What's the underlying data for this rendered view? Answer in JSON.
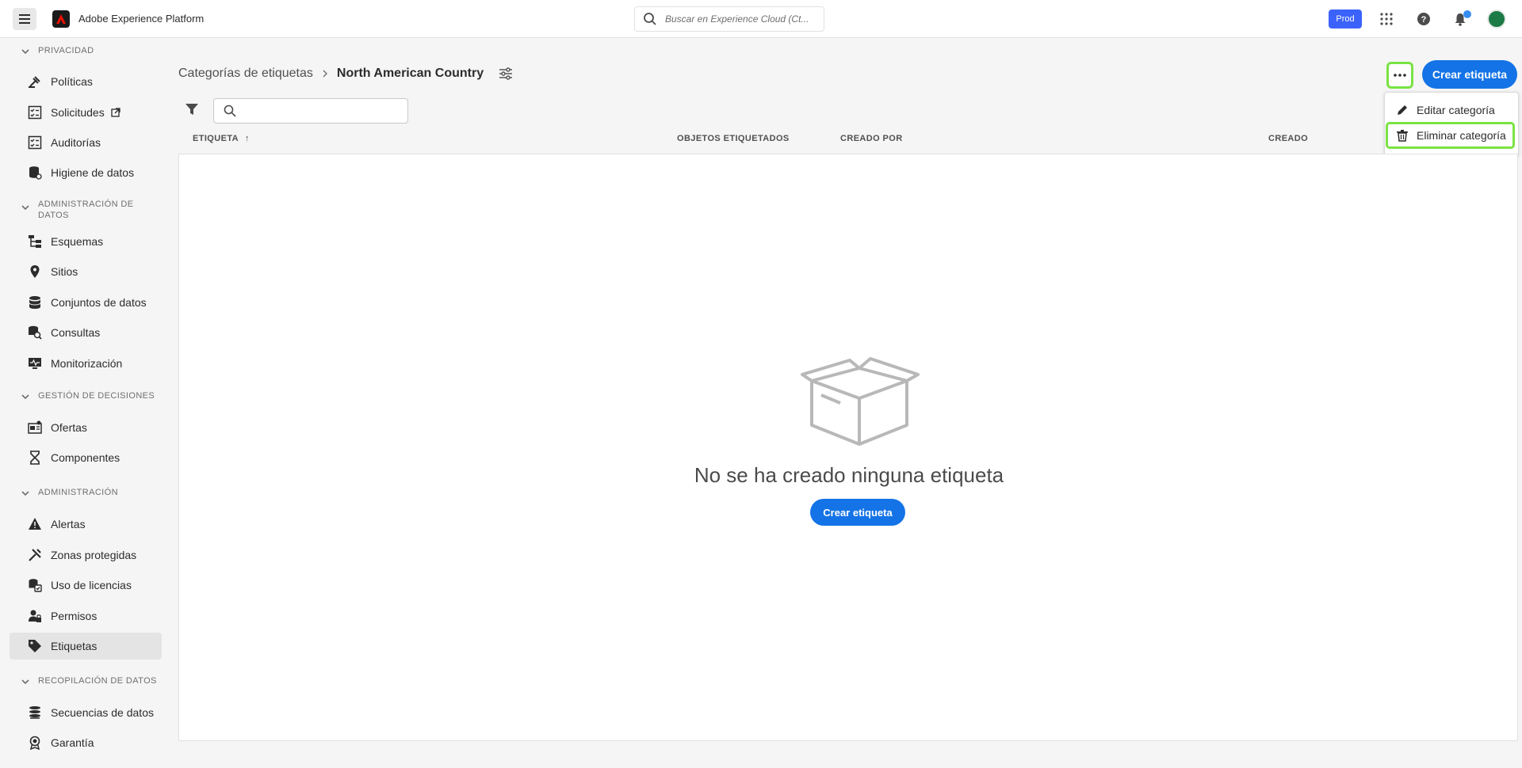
{
  "app": {
    "title": "Adobe Experience Platform"
  },
  "search": {
    "placeholder": "Buscar en Experience Cloud (Ct..."
  },
  "topbar": {
    "sandbox": "Prod"
  },
  "sidebar": {
    "sections": [
      {
        "label": "PRIVACIDAD"
      },
      {
        "label": "ADMINISTRACIÓN DE DATOS"
      },
      {
        "label": "GESTIÓN DE DECISIONES"
      },
      {
        "label": "ADMINISTRACIÓN"
      },
      {
        "label": "RECOPILACIÓN DE DATOS"
      }
    ],
    "items": [
      {
        "label": "Políticas",
        "icon": "policy-icon"
      },
      {
        "label": "Solicitudes",
        "icon": "checklist-icon"
      },
      {
        "label": "Auditorías",
        "icon": "audit-icon"
      },
      {
        "label": "Higiene de datos",
        "icon": "database-clean-icon"
      },
      {
        "label": "Esquemas",
        "icon": "schema-icon"
      },
      {
        "label": "Sitios",
        "icon": "location-pin-icon"
      },
      {
        "label": "Conjuntos de datos",
        "icon": "database-icon"
      },
      {
        "label": "Consultas",
        "icon": "query-icon"
      },
      {
        "label": "Monitorización",
        "icon": "monitor-icon"
      },
      {
        "label": "Ofertas",
        "icon": "offers-icon"
      },
      {
        "label": "Componentes",
        "icon": "hourglass-icon"
      },
      {
        "label": "Alertas",
        "icon": "alert-icon"
      },
      {
        "label": "Zonas protegidas",
        "icon": "tools-icon"
      },
      {
        "label": "Uso de licencias",
        "icon": "license-icon"
      },
      {
        "label": "Permisos",
        "icon": "user-lock-icon"
      },
      {
        "label": "Etiquetas",
        "icon": "tag-icon"
      },
      {
        "label": "Secuencias de datos",
        "icon": "datastream-icon"
      },
      {
        "label": "Garantía",
        "icon": "award-icon"
      }
    ]
  },
  "breadcrumb": {
    "parent": "Categorías de etiquetas",
    "current": "North American Country"
  },
  "actions": {
    "create_label": "Crear etiqueta"
  },
  "menu": {
    "edit": "Editar categoría",
    "delete": "Eliminar categoría"
  },
  "table": {
    "columns": [
      "ETIQUETA",
      "OBJETOS ETIQUETADOS",
      "CREADO POR",
      "CREADO"
    ]
  },
  "empty": {
    "message": "No se ha creado ninguna etiqueta",
    "button": "Crear etiqueta"
  },
  "colors": {
    "accent": "#1473e6",
    "highlight": "#79e342",
    "sandbox": "#3b63fb"
  }
}
